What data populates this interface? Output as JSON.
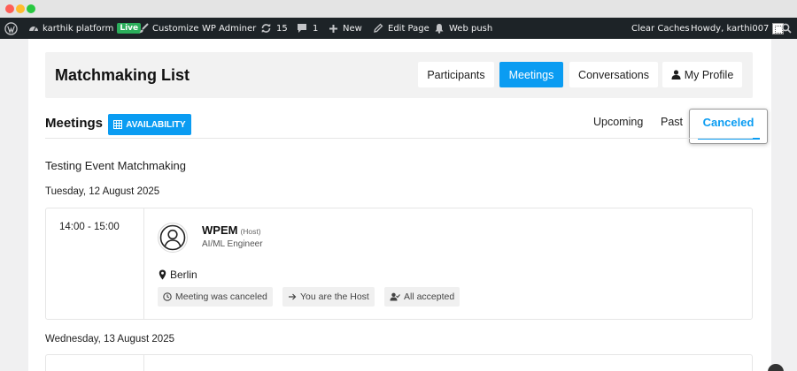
{
  "adminbar": {
    "site_name": "karthik platform",
    "live_badge": "Live",
    "customize": "Customize",
    "wp_adminer": "WP Adminer",
    "updates_count": "15",
    "comments_count": "1",
    "new": "New",
    "edit_page": "Edit Page",
    "web_push": "Web push",
    "clear_caches": "Clear Caches",
    "howdy": "Howdy, karthi007"
  },
  "header": {
    "title": "Matchmaking List",
    "nav": {
      "participants": "Participants",
      "meetings": "Meetings",
      "conversations": "Conversations",
      "my_profile": "My Profile"
    }
  },
  "meetings": {
    "title": "Meetings",
    "availability_label": "AVAILABILITY",
    "filters": {
      "upcoming": "Upcoming",
      "past": "Past",
      "canceled": "Canceled"
    },
    "active_filter": "canceled",
    "event_name": "Testing Event Matchmaking",
    "groups": [
      {
        "date": "Tuesday, 12 August 2025",
        "meeting": {
          "time": "14:00 - 15:00",
          "participant_name": "WPEM",
          "participant_tag": "(Host)",
          "participant_role": "AI/ML Engineer",
          "location": "Berlin",
          "badges": [
            {
              "icon": "clock-icon",
              "text": "Meeting was canceled"
            },
            {
              "icon": "arrow-right-icon",
              "text": "You are the Host"
            },
            {
              "icon": "users-check-icon",
              "text": "All accepted"
            }
          ]
        }
      },
      {
        "date": "Wednesday, 13 August 2025"
      }
    ]
  },
  "colors": {
    "accent": "#0a9cf2",
    "adminbar_bg": "#1d2327",
    "live_green": "#2bae5b"
  }
}
